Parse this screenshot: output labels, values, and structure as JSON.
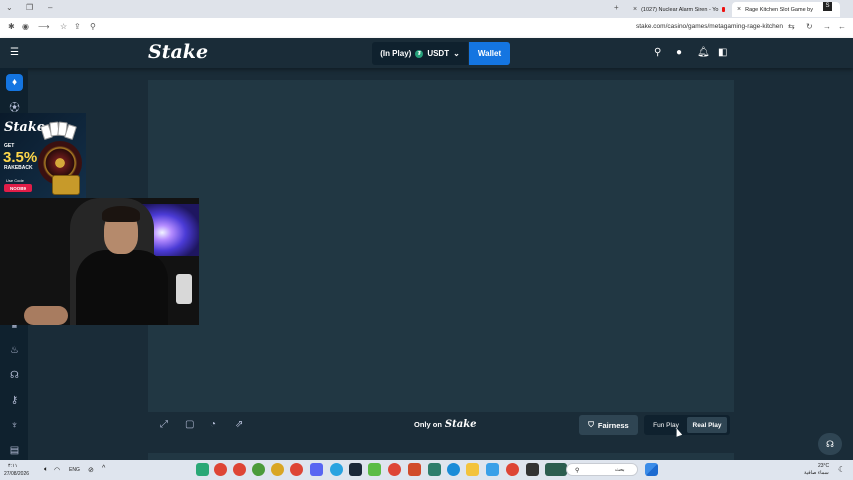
{
  "browser": {
    "tabs": [
      {
        "title": "(1027) Nuclear Alarm Siren - Yo"
      },
      {
        "title": "Rage Kitchen Slot Game by"
      }
    ],
    "url": "stake.com/casino/games/metagaming-rage-kitchen"
  },
  "header": {
    "logo": "Stake",
    "balance_label": "(In Play)",
    "currency": "USDT",
    "wallet_label": "Wallet"
  },
  "promo": {
    "logo": "Stake",
    "get": "GET",
    "percent": "3.5%",
    "rakeback": "RAKEBACK",
    "use_code": "Use Code",
    "code": "NOOB9"
  },
  "game_footer": {
    "only_on": "Only on",
    "only_on_brand": "Stake",
    "fairness": "Fairness",
    "fun_play": "Fun Play",
    "real_play": "Real Play"
  },
  "taskbar": {
    "time": "۴:۱۱",
    "date": "27/08/2026",
    "language": "ENG",
    "search_placeholder": "بحث",
    "temperature": "23°C",
    "weather": "سماء صافية"
  },
  "colors": {
    "bg": "#1a2c38",
    "game_bg": "#213743",
    "accent": "#1475e1",
    "sidebar_bg": "#0f212e"
  }
}
